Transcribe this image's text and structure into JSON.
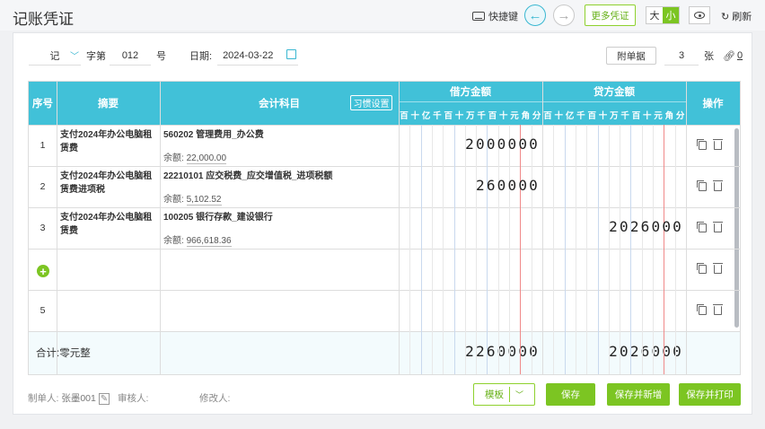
{
  "page": {
    "title": "记账凭证"
  },
  "toolbar": {
    "shortcut_label": "快捷键",
    "more_voucher": "更多凭证",
    "size_large": "大",
    "size_small": "小",
    "refresh_label": "刷新"
  },
  "header": {
    "word_value": "记",
    "word_label": "字第",
    "number_value": "012",
    "number_unit": "号",
    "date_label": "日期:",
    "date_value": "2024-03-22",
    "attach_button": "附单据",
    "attach_count": "3",
    "attach_unit": "张",
    "link_count": "0"
  },
  "table": {
    "columns": {
      "seq": "序号",
      "summary": "摘要",
      "account": "会计科目",
      "habit_button": "习惯设置",
      "debit": "借方金额",
      "credit": "贷方金额",
      "action": "操作"
    },
    "digit_units": [
      "百",
      "十",
      "亿",
      "千",
      "百",
      "十",
      "万",
      "千",
      "百",
      "十",
      "元",
      "角",
      "分"
    ],
    "balance_label": "余额:",
    "rows": [
      {
        "seq": "1",
        "summary": "支付2024年办公电脑租赁费",
        "account": "560202 管理费用_办公费",
        "balance": "22,000.00",
        "debit": "2000000",
        "credit": ""
      },
      {
        "seq": "2",
        "summary": "支付2024年办公电脑租赁费进项税",
        "account": "22210101 应交税费_应交增值税_进项税额",
        "balance": "5,102.52",
        "debit": "260000",
        "credit": ""
      },
      {
        "seq": "3",
        "summary": "支付2024年办公电脑租赁费",
        "account": "100205 银行存款_建设银行",
        "balance": "966,618.36",
        "debit": "",
        "credit": "2026000"
      },
      {
        "seq": "",
        "summary": "",
        "account": "",
        "balance": "",
        "debit": "",
        "credit": ""
      },
      {
        "seq": "5",
        "summary": "",
        "account": "",
        "balance": "",
        "debit": "",
        "credit": ""
      }
    ],
    "total": {
      "label": "合计:",
      "amount_words": "零元整",
      "debit": "2260000",
      "credit": "2026000"
    }
  },
  "footer": {
    "maker_label": "制单人:",
    "maker_value": "张墨001",
    "reviewer_label": "审核人:",
    "modifier_label": "修改人:",
    "template_button": "模板",
    "save_button": "保存",
    "save_new_button": "保存并新增",
    "save_print_button": "保存并打印"
  },
  "colors": {
    "accent": "#41c1d8",
    "green": "#7cc522",
    "divider_red": "#f08a8a"
  }
}
